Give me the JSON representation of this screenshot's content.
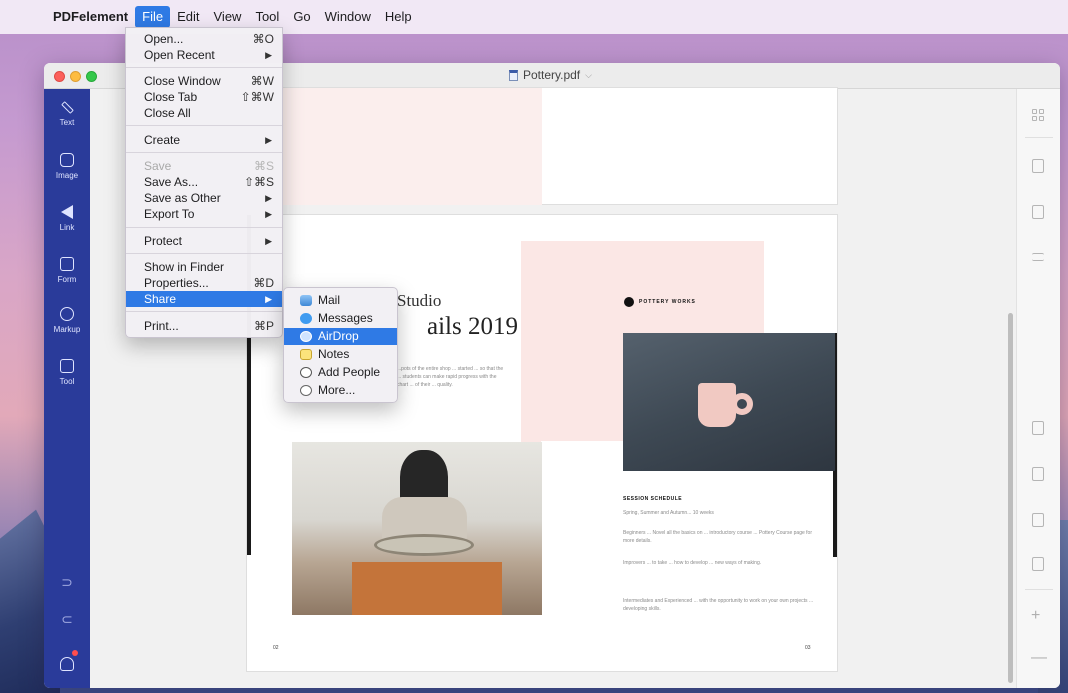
{
  "menubar": {
    "app_name": "PDFelement",
    "items": [
      "File",
      "Edit",
      "View",
      "Tool",
      "Go",
      "Window",
      "Help"
    ]
  },
  "window": {
    "title": "Pottery.pdf"
  },
  "left_toolbar": {
    "tools": [
      "Text",
      "Image",
      "Link",
      "Form",
      "Markup",
      "Tool"
    ]
  },
  "file_menu": {
    "items": [
      {
        "label": "Open...",
        "shortcut": "⌘O"
      },
      {
        "label": "Open Recent",
        "submenu": "▶"
      },
      {
        "label": "Close Window",
        "shortcut": "⌘W"
      },
      {
        "label": "Close Tab",
        "shortcut": "⇧⌘W"
      },
      {
        "label": "Close All"
      },
      {
        "label": "Create",
        "submenu": "▶"
      },
      {
        "label": "Save",
        "shortcut": "⌘S",
        "disabled": true
      },
      {
        "label": "Save As...",
        "shortcut": "⇧⌘S"
      },
      {
        "label": "Save as Other",
        "submenu": "▶"
      },
      {
        "label": "Export To",
        "submenu": "▶"
      },
      {
        "label": "Protect",
        "submenu": "▶"
      },
      {
        "label": "Show in Finder"
      },
      {
        "label": "Properties...",
        "shortcut": "⌘D"
      },
      {
        "label": "Share",
        "submenu": "▶"
      },
      {
        "label": "Print...",
        "shortcut": "⌘P"
      }
    ]
  },
  "share_menu": {
    "items": [
      {
        "label": "Mail",
        "icon": "mail-icon"
      },
      {
        "label": "Messages",
        "icon": "messages-icon"
      },
      {
        "label": "AirDrop",
        "icon": "airdrop-icon"
      },
      {
        "label": "Notes",
        "icon": "notes-icon"
      },
      {
        "label": "Add People",
        "icon": "add-people-icon"
      },
      {
        "label": "More...",
        "icon": "more-icon"
      }
    ]
  },
  "document": {
    "studio_text": "Studio",
    "details_text": "ails 2019",
    "logo_text": "POTTERY WORKS",
    "section_title": "SESSION SCHEDULE",
    "body_left": "...pots of the entire shop ... started ... so that the ... students can make rapid progress with the chart ... of their ... quality.",
    "body_right_1": "Spring, Summer and Autumn... 10 weeks",
    "body_right_2": "Beginners ... Novel all the basics on ... introductory course ... Pottery Course page for more details.",
    "body_right_3": "Improvers ... to take ... how to develop ... new ways of making.",
    "body_right_4": "Intermediates and Experienced ... with the opportunity to work on your own projects ... developing skills.",
    "page_left": "02",
    "page_right": "03"
  },
  "colors": {
    "accent": "#2f7ae5",
    "sidebar": "#2a3b9a",
    "pink": "#fbe7e5"
  }
}
